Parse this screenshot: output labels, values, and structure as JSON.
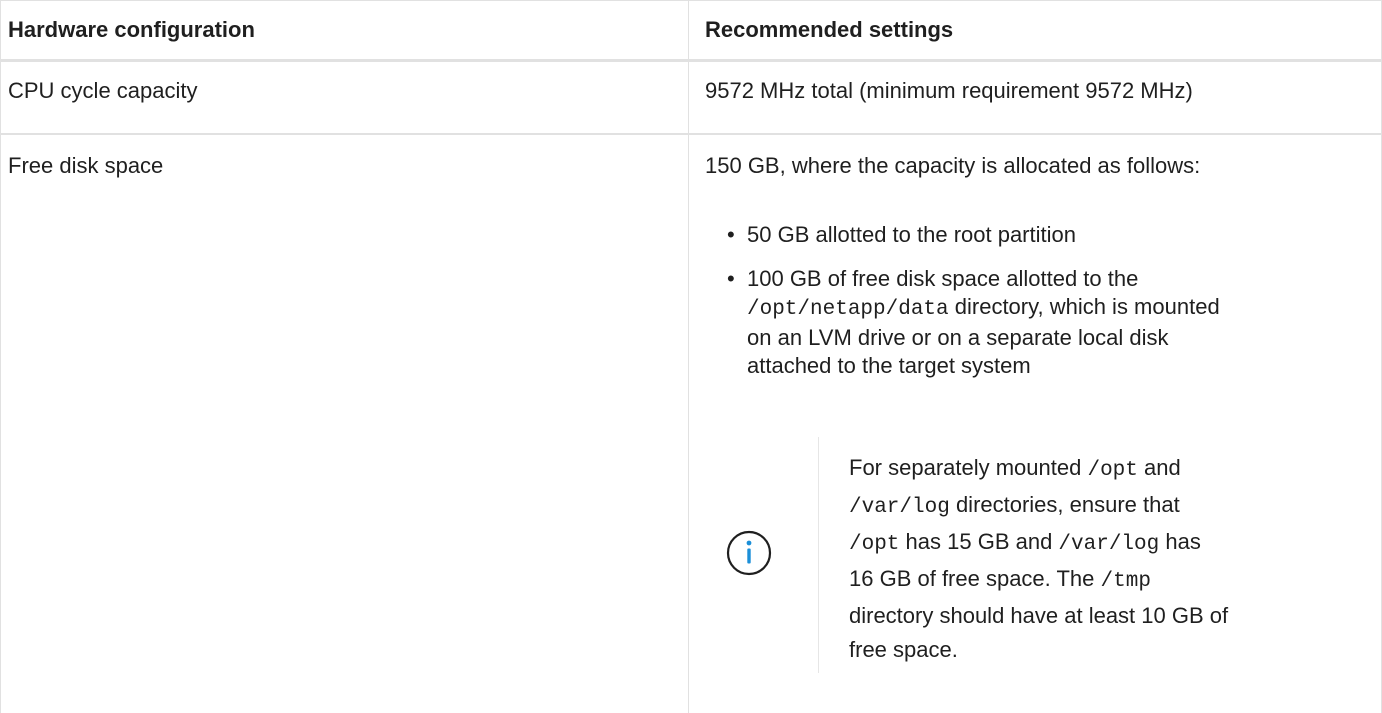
{
  "table": {
    "headers": [
      "Hardware configuration",
      "Recommended settings"
    ],
    "cpu_row": {
      "label": "CPU cycle capacity",
      "value": "9572 MHz total (minimum requirement 9572 MHz)"
    },
    "disk_row": {
      "label": "Free disk space",
      "intro": "150 GB, where the capacity is allocated as follows:",
      "bullets": [
        {
          "text": "50 GB allotted to the root partition"
        },
        {
          "pre": "100 GB of free disk space allotted to the",
          "code": "/opt/netapp/data",
          "post_same_line": " directory, which is mounted",
          "post_line2": "on an LVM drive or on a separate local disk",
          "post_line3": "attached to the target system"
        }
      ],
      "note": {
        "icon": "info-icon",
        "line1_pre": "For separately mounted ",
        "line1_code": "/opt",
        "line1_post": " and",
        "line2_code": "/var/log",
        "line2_post": " directories, ensure that",
        "line3_code1": "/opt",
        "line3_mid": " has 15 GB and ",
        "line3_code2": "/var/log",
        "line3_post": " has",
        "line4_pre": "16 GB of free space. The ",
        "line4_code": "/tmp",
        "line5": "directory should have at least 10 GB of",
        "line6": "free space."
      }
    }
  },
  "colors": {
    "border": "#e1e1e1",
    "text": "#1f1f1f",
    "info_icon": "#1b8fd8"
  }
}
